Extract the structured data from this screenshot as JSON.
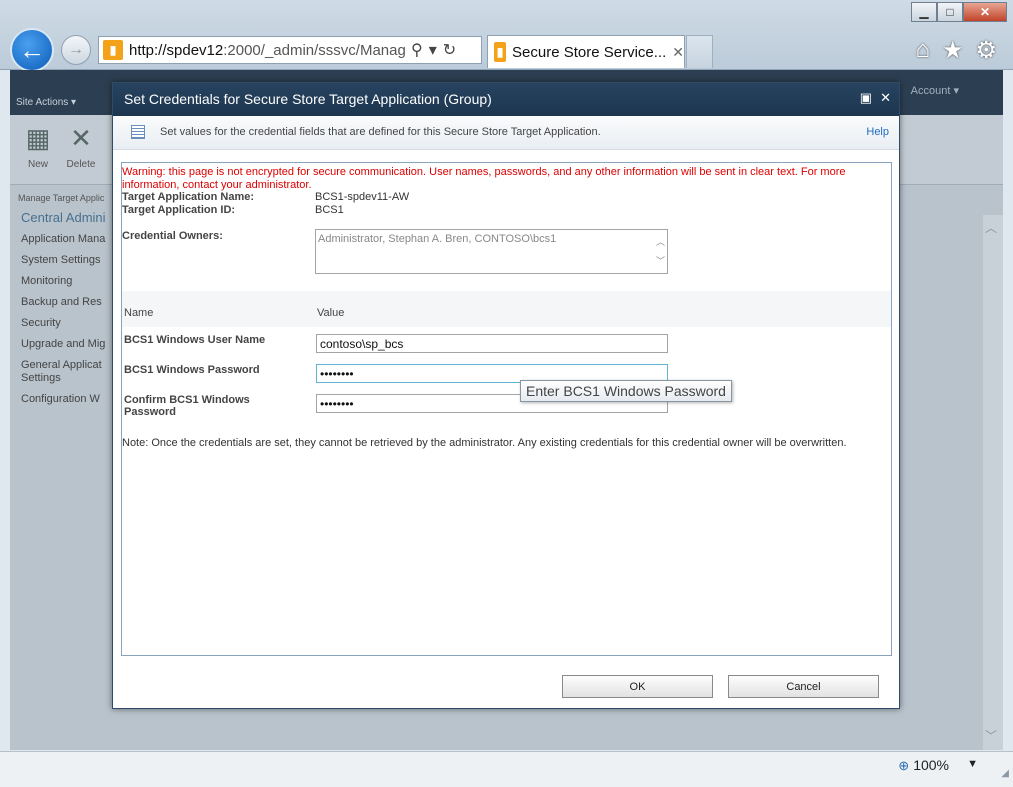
{
  "browser": {
    "url_host": "http://spdev12",
    "url_rest": ":2000/_admin/sssvc/Manag",
    "tab_title": "Secure Store Service...",
    "zoom": "100%"
  },
  "page": {
    "site_actions": "Site Actions",
    "account": "Account",
    "ribbon": {
      "new_label": "New",
      "delete_label": "Delete"
    },
    "breadcrumb": "Manage Target Applic",
    "leftnav": {
      "title": "Central Admini",
      "items": [
        "Application Mana",
        "System Settings",
        "Monitoring",
        "Backup and Res",
        "Security",
        "Upgrade and Mig",
        "General Applicat Settings",
        "Configuration W"
      ]
    }
  },
  "dialog": {
    "title": "Set Credentials for Secure Store Target Application (Group)",
    "info_text": "Set values for the credential fields that are defined for this Secure Store Target Application.",
    "help": "Help",
    "warning": "Warning: this page is not encrypted for secure communication. User names, passwords, and any other information will be sent in clear text. For more information, contact your administrator.",
    "target_app_name_label": "Target Application Name:",
    "target_app_name": "BCS1-spdev11-AW",
    "target_app_id_label": "Target Application ID:",
    "target_app_id": "BCS1",
    "credential_owners_label": "Credential Owners:",
    "credential_owners": "Administrator, Stephan A. Bren, CONTOSO\\bcs1",
    "col_name": "Name",
    "col_value": "Value",
    "username_label": "BCS1 Windows User Name",
    "username_value": "contoso\\sp_bcs",
    "password_label": "BCS1 Windows Password",
    "password_value": "••••••••",
    "confirm_label": "Confirm BCS1 Windows Password",
    "confirm_value": "••••••••",
    "tooltip": "Enter BCS1 Windows Password",
    "note": "Note: Once the credentials are set, they cannot be retrieved by the administrator. Any existing credentials for this credential owner will be overwritten.",
    "ok": "OK",
    "cancel": "Cancel"
  }
}
